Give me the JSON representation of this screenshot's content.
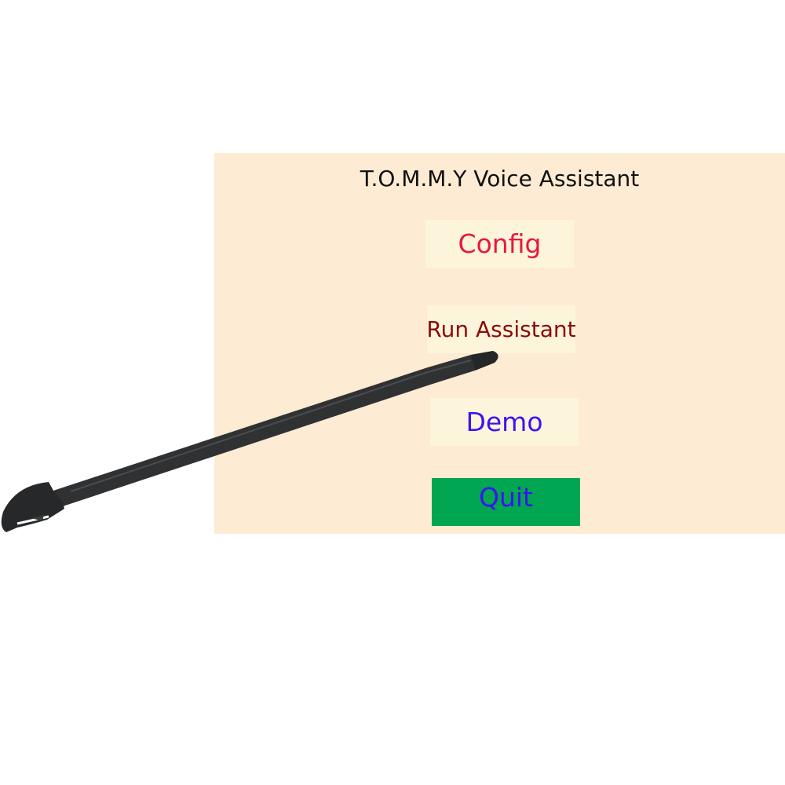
{
  "window": {
    "title": "T.O.M.M.Y Voice Assistant"
  },
  "buttons": {
    "config": {
      "label": "Config",
      "color": "#e8183f"
    },
    "run": {
      "label": "Run Assistant",
      "color": "#8b0a0a"
    },
    "demo": {
      "label": "Demo",
      "color": "#3a14f2"
    },
    "quit": {
      "label": "Quit",
      "color": "#3a14f2",
      "background": "#00a651"
    }
  },
  "colors": {
    "window_bg": "#fdebd3",
    "button_bg": "#fdf4dc"
  },
  "stylus": {
    "icon": "stylus-pen-icon"
  }
}
